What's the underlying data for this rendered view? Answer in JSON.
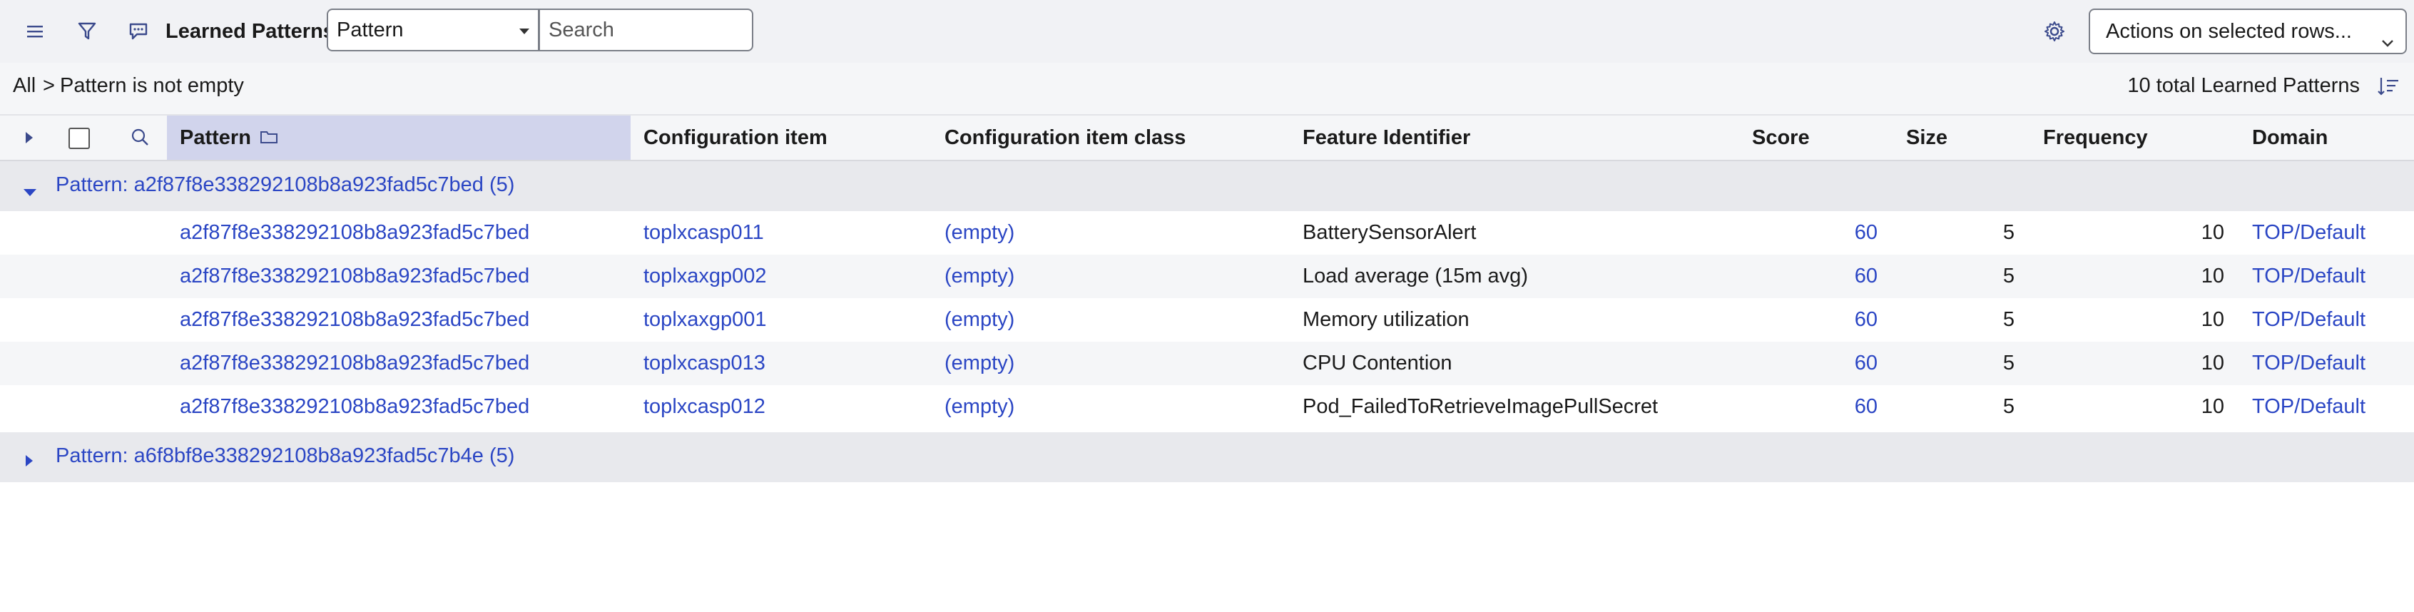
{
  "toolbar": {
    "title": "Learned Patterns",
    "field_select": "Pattern",
    "search_placeholder": "Search",
    "actions_label": "Actions on selected rows..."
  },
  "breadcrumb": {
    "all": "All",
    "separator": ">",
    "filter": "Pattern is not empty",
    "total": "10 total Learned Patterns"
  },
  "columns": [
    "Pattern",
    "Configuration item",
    "Configuration item class",
    "Feature Identifier",
    "Score",
    "Size",
    "Frequency",
    "Domain"
  ],
  "groups": [
    {
      "label": "Pattern: a2f87f8e338292108b8a923fad5c7bed (5)",
      "expanded": true,
      "rows": [
        {
          "pattern": "a2f87f8e338292108b8a923fad5c7bed",
          "ci": "toplxcasp011",
          "ci_class": "(empty)",
          "feature": "BatterySensorAlert",
          "score": "60",
          "size": "5",
          "frequency": "10",
          "domain": "TOP/Default"
        },
        {
          "pattern": "a2f87f8e338292108b8a923fad5c7bed",
          "ci": "toplxaxgp002",
          "ci_class": "(empty)",
          "feature": "Load average (15m avg)",
          "score": "60",
          "size": "5",
          "frequency": "10",
          "domain": "TOP/Default"
        },
        {
          "pattern": "a2f87f8e338292108b8a923fad5c7bed",
          "ci": "toplxaxgp001",
          "ci_class": "(empty)",
          "feature": "Memory utilization",
          "score": "60",
          "size": "5",
          "frequency": "10",
          "domain": "TOP/Default"
        },
        {
          "pattern": "a2f87f8e338292108b8a923fad5c7bed",
          "ci": "toplxcasp013",
          "ci_class": "(empty)",
          "feature": "CPU Contention",
          "score": "60",
          "size": "5",
          "frequency": "10",
          "domain": "TOP/Default"
        },
        {
          "pattern": "a2f87f8e338292108b8a923fad5c7bed",
          "ci": "toplxcasp012",
          "ci_class": "(empty)",
          "feature": "Pod_FailedToRetrieveImagePullSecret",
          "score": "60",
          "size": "5",
          "frequency": "10",
          "domain": "TOP/Default"
        }
      ]
    },
    {
      "label": "Pattern: a6f8bf8e338292108b8a923fad5c7b4e (5)",
      "expanded": false,
      "rows": []
    }
  ],
  "icons": {
    "menu": "hamburger-menu-icon",
    "filter": "funnel-icon",
    "comment": "comment-icon",
    "gear": "gear-icon",
    "search": "search-icon",
    "folder": "folder-icon",
    "sort": "sort-icon"
  },
  "colors": {
    "link": "#2b46c4",
    "pattern_header_bg": "#d1d4ec",
    "group_bg": "#e8e9ed",
    "toolbar_bg": "#f1f2f5"
  }
}
